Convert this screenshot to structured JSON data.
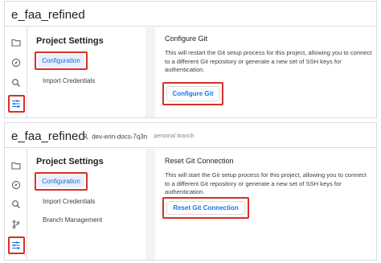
{
  "panels": [
    {
      "project_title": "e_faa_refined",
      "settings_title": "Project Settings",
      "menu": [
        "Configuration",
        "Import Credentials"
      ],
      "content_title": "Configure Git",
      "content_desc": "This will restart the Git setup process for this project, allowing you to connect to a different Git repository or generate a new set of SSH keys for authentication.",
      "button_label": "Configure Git"
    },
    {
      "project_title": "e_faa_refined",
      "branch_name": "dev-erin-docs-7q3n",
      "branch_tag": "personal branch",
      "settings_title": "Project Settings",
      "menu": [
        "Configuration",
        "Import Credentials",
        "Branch Management"
      ],
      "content_title": "Reset Git Connection",
      "content_desc": "This will start the Git setup process for this project, allowing you to connect to a different Git repository or generate a new set of SSH keys for authentication.",
      "button_label": "Reset Git Connection"
    }
  ],
  "rail_icons": [
    "folder-icon",
    "compass-icon",
    "search-icon",
    "git-branch-icon",
    "settings-sliders-icon"
  ],
  "colors": {
    "highlight": "#d93025",
    "accent": "#1a73e8",
    "active_bg": "#e8f0fe"
  }
}
